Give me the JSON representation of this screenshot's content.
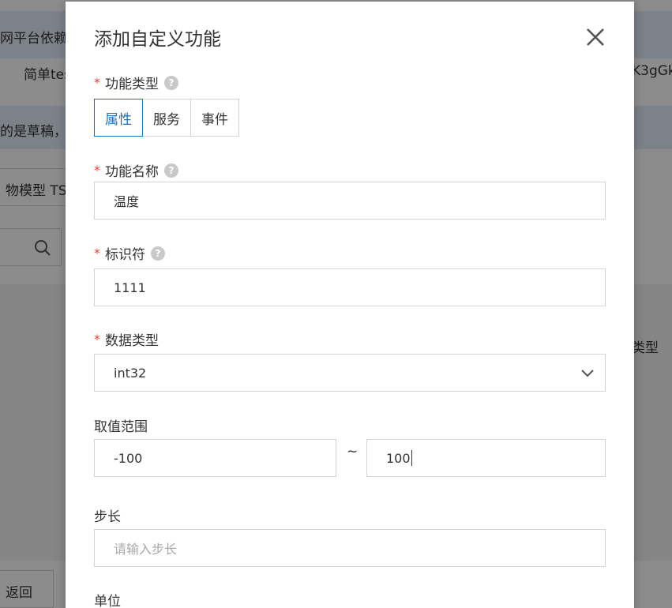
{
  "background": {
    "row1_text": "网平台依赖",
    "row2_left": "简单tes",
    "row2_right": "K3gGk",
    "notice_text": "的是草稿，",
    "tab_text": "物模型 TS",
    "column_header": "类型",
    "back_label": "返回"
  },
  "modal": {
    "title": "添加自定义功能",
    "function_type": {
      "label": "功能类型",
      "options": [
        "属性",
        "服务",
        "事件"
      ],
      "selected": "属性"
    },
    "function_name": {
      "label": "功能名称",
      "value": "温度"
    },
    "identifier": {
      "label": "标识符",
      "value": "1111"
    },
    "data_type": {
      "label": "数据类型",
      "value": "int32"
    },
    "range": {
      "label": "取值范围",
      "min": "-100",
      "separator": "~",
      "max": "100"
    },
    "step": {
      "label": "步长",
      "placeholder": "请输入步长"
    },
    "unit": {
      "label": "单位"
    }
  }
}
